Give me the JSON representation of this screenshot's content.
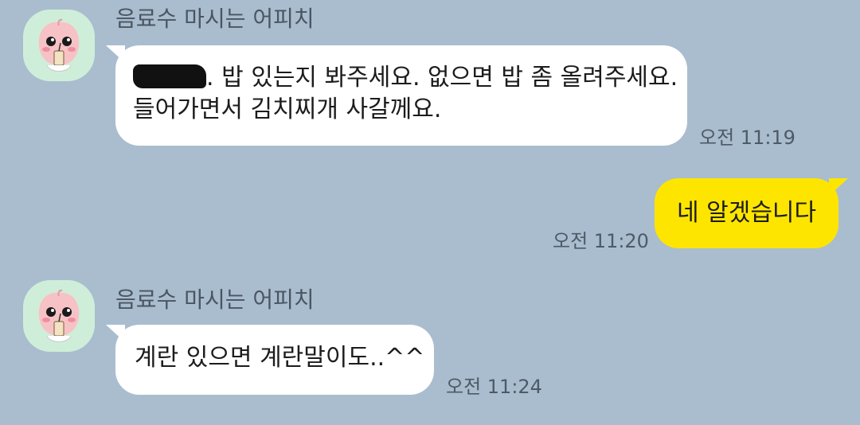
{
  "chat": {
    "messages": [
      {
        "sender": "음료수 마시는 어피치",
        "direction": "in",
        "lines": [
          "밥 있는지 봐주세요. 없으면 밥 좀 올려주세요.",
          "들어가면서 김치찌개 사갈께요."
        ],
        "time": "오전 11:19"
      },
      {
        "direction": "out",
        "text": "네 알겠습니다",
        "time": "오전 11:20"
      },
      {
        "sender": "음료수 마시는 어피치",
        "direction": "in",
        "text": "계란 있으면 계란말이도..^^",
        "time": "오전 11:24"
      }
    ]
  },
  "icons": {
    "avatar": "peach-character-icon"
  },
  "colors": {
    "background": "#a9bdcf",
    "incoming_bubble": "#ffffff",
    "outgoing_bubble": "#fee500",
    "avatar_bg": "#cfeed9"
  }
}
